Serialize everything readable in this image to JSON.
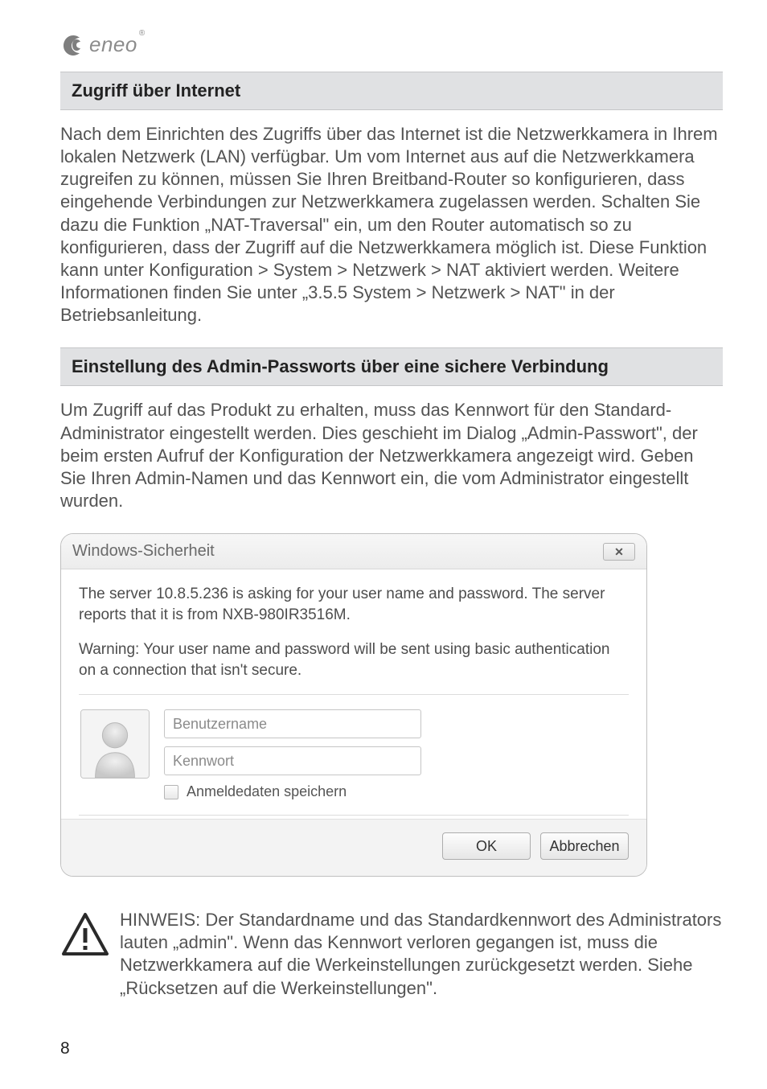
{
  "logo": {
    "brand": "eneo",
    "trademark": "®"
  },
  "section1": {
    "title": "Zugriff über Internet",
    "body": "Nach dem Einrichten des Zugriffs über das Internet ist die Netzwerkkamera in Ihrem lokalen Netzwerk (LAN) verfügbar. Um vom Internet aus auf die Netzwerkkamera zugreifen zu können, müssen Sie Ihren Breitband-Router so konfigurieren, dass eingehende Verbindungen zur Netzwerkkamera zugelassen werden. Schalten Sie dazu die Funktion „NAT-Traversal\" ein, um den Router automatisch so zu konfigurieren, dass der Zugriff auf die Netzwerkkamera möglich ist. Diese Funktion kann unter Konfiguration > System > Netzwerk > NAT aktiviert werden. Weitere Informationen finden Sie unter „3.5.5 System > Netzwerk > NAT\" in der Betriebsanleitung."
  },
  "section2": {
    "title": "Einstellung des Admin-Passworts über eine sichere Verbindung",
    "body": "Um Zugriff auf das Produkt zu erhalten, muss das Kennwort für den Standard-Administrator eingestellt werden. Dies geschieht im Dialog „Admin-Passwort\", der beim ersten Aufruf der Konfiguration der Netzwerkkamera angezeigt wird. Geben Sie Ihren Admin-Namen und das Kennwort ein, die vom Administrator eingestellt wurden."
  },
  "dialog": {
    "title": "Windows-Sicherheit",
    "msg1": "The server 10.8.5.236 is asking for your user name and password. The server reports that it is from NXB-980IR3516M.",
    "msg2": "Warning: Your user name and password will be sent using basic authentication on a connection that isn't secure.",
    "user_placeholder": "Benutzername",
    "pass_placeholder": "Kennwort",
    "remember_label": "Anmeldedaten speichern",
    "ok_label": "OK",
    "cancel_label": "Abbrechen"
  },
  "hint": {
    "text": "HINWEIS: Der Standardname und das Standardkennwort des Administrators lauten „admin\". Wenn das Kennwort verloren gegangen ist, muss die Netzwerkkamera auf die Werkeinstellungen zurückgesetzt werden. Siehe „Rücksetzen auf die Werkeinstellungen\"."
  },
  "page_number": "8"
}
